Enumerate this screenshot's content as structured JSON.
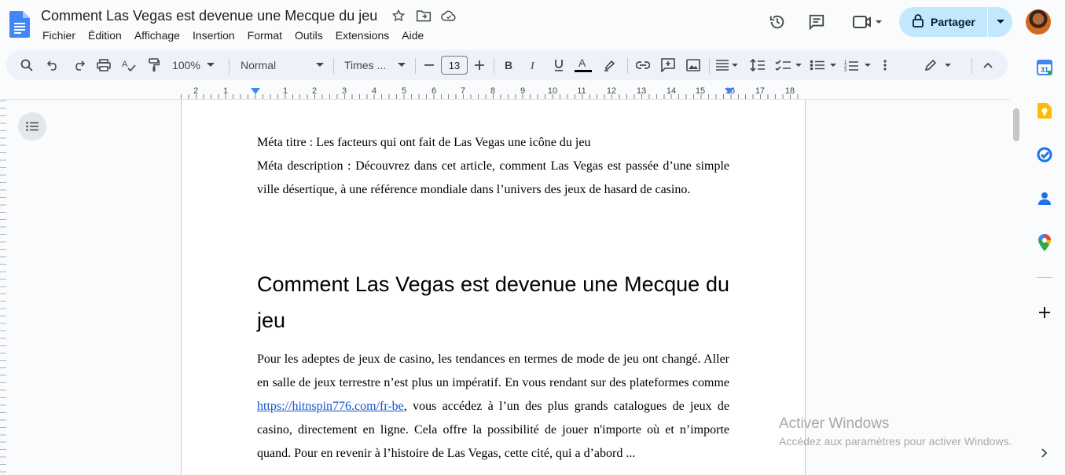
{
  "app": {
    "document_title": "Comment Las Vegas est devenue une Mecque du jeu",
    "title_icons": [
      "star-icon",
      "move-folder-icon",
      "cloud-status-icon"
    ]
  },
  "menu": {
    "items": [
      "Fichier",
      "Édition",
      "Affichage",
      "Insertion",
      "Format",
      "Outils",
      "Extensions",
      "Aide"
    ]
  },
  "header_actions": {
    "icons": [
      "version-history-icon",
      "comments-icon",
      "meet-icon"
    ],
    "share_label": "Partager"
  },
  "toolbar": {
    "zoom": "100%",
    "paragraph_style": "Normal",
    "font": "Times ...",
    "font_size": "13"
  },
  "ruler": {
    "labels": [
      "2",
      "1",
      "",
      "1",
      "2",
      "3",
      "4",
      "5",
      "6",
      "7",
      "8",
      "9",
      "10",
      "11",
      "12",
      "13",
      "14",
      "15",
      "16",
      "17",
      "18"
    ]
  },
  "document": {
    "meta_title": "Méta titre : Les facteurs qui ont fait de Las Vegas une icône du jeu",
    "meta_description": "Méta description : Découvrez dans cet article, comment Las Vegas est passée d’une simple ville désertique, à une référence mondiale dans l’univers des jeux de hasard de casino.",
    "heading": "Comment Las Vegas est devenue une Mecque du jeu",
    "para_before_link": "Pour les adeptes de jeux de casino, les tendances en termes de mode de jeu ont changé. Aller en salle de jeux terrestre n’est plus un impératif. En vous rendant sur des plateformes comme ",
    "link": "https://hitnspin776.com/fr-be",
    "para_after_link": ", vous accédez à l’un des plus grands catalogues de jeux de casino, directement en ligne. Cela offre la possibilité de jouer n'importe où et n’importe quand. Pour en revenir à l’histoire de Las Vegas, cette cité, qui a d’abord ..."
  },
  "watermark": {
    "title": "Activer Windows",
    "subtitle": "Accédez aux paramètres pour activer Windows."
  },
  "colors": {
    "accent": "#1a73e8",
    "share_bg": "#c2e7ff",
    "toolbar_bg": "#edf2fa",
    "link": "#1155cc"
  }
}
